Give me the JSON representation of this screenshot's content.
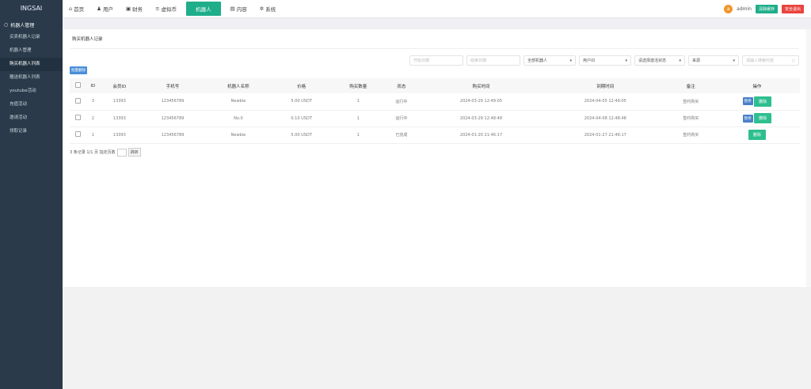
{
  "app": {
    "logo": "INGSAI"
  },
  "sidebar": {
    "group": "机器人管理",
    "items": [
      {
        "label": "买卖机器人记录"
      },
      {
        "label": "机器人管理"
      },
      {
        "label": "购买机器人列表",
        "active": true
      },
      {
        "label": "赠送机器人列表"
      },
      {
        "label": "youtube活动"
      },
      {
        "label": "充值活动"
      },
      {
        "label": "邀请活动"
      },
      {
        "label": "领取记录"
      }
    ]
  },
  "topnav": {
    "items": [
      {
        "label": "首页",
        "icon": "home-icon"
      },
      {
        "label": "用户",
        "icon": "user-icon"
      },
      {
        "label": "财务",
        "icon": "gift-icon"
      },
      {
        "label": "虚拟币",
        "icon": "database-icon"
      },
      {
        "label": "机器人",
        "active": true
      },
      {
        "label": "内容",
        "icon": "document-icon"
      },
      {
        "label": "系统",
        "icon": "gear-icon"
      }
    ],
    "avatar": "a",
    "user": "admin",
    "clear_cache": "清除缓存",
    "logout": "安全退出"
  },
  "page": {
    "title": "购买机器人记录"
  },
  "filters": {
    "start_date": "开始日期",
    "end_date": "结束日期",
    "robot": "全部机器人",
    "user": "用户ID",
    "status": "请选择激活状态",
    "source": "来源",
    "search_placeholder": "请输入搜索内容"
  },
  "bulk_delete": "批量删除",
  "table": {
    "headers": [
      "ID",
      "会员ID",
      "手机号",
      "机器人名称",
      "价格",
      "购买数量",
      "状态",
      "购买时间",
      "到期时间",
      "备注",
      "操作"
    ],
    "rows": [
      [
        "3",
        "13393",
        "123456789",
        "Newbie",
        "5.00 USDT",
        "1",
        "运行中",
        "2024-03-29 12:49:05",
        "2024-04-05 12:49:05",
        "签约购买"
      ],
      [
        "2",
        "13393",
        "123456789",
        "No.0",
        "0.10 USDT",
        "1",
        "运行中",
        "2024-03-29 12:48:48",
        "2024-04-08 12:48:48",
        "签约购买"
      ],
      [
        "1",
        "13393",
        "123456789",
        "Newbie",
        "5.00 USDT",
        "1",
        "已完成",
        "2024-01-20 21:46:17",
        "2024-01-27 21:46:17",
        "签约购买"
      ]
    ],
    "pause": "暂停",
    "delete": "删除"
  },
  "pagination": {
    "summary": "3 条记录 1/1 页 指定页数",
    "go": "跳转"
  }
}
